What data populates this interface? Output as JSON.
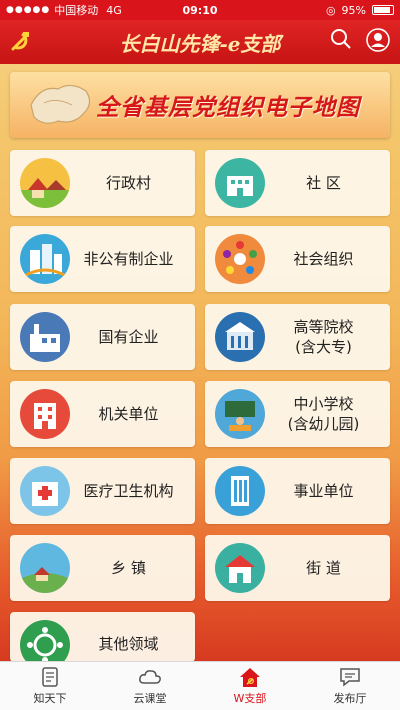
{
  "status_bar": {
    "carrier": "中国移动",
    "network": "4G",
    "time": "09:10",
    "battery": "95%"
  },
  "nav": {
    "title": "长白山先锋-e支部"
  },
  "banner": {
    "text": "全省基层党组织电子地图"
  },
  "categories": [
    {
      "label": "行政村"
    },
    {
      "label": "社 区"
    },
    {
      "label": "非公有制企业"
    },
    {
      "label": "社会组织"
    },
    {
      "label": "国有企业"
    },
    {
      "label": "高等院校\n(含大专)"
    },
    {
      "label": "机关单位"
    },
    {
      "label": "中小学校\n(含幼儿园)"
    },
    {
      "label": "医疗卫生机构"
    },
    {
      "label": "事业单位"
    },
    {
      "label": "乡 镇"
    },
    {
      "label": "街 道"
    },
    {
      "label": "其他领域"
    }
  ],
  "tabs": [
    {
      "label": "知天下",
      "icon": "news-icon"
    },
    {
      "label": "云课堂",
      "icon": "cloud-icon"
    },
    {
      "label": "W支部",
      "icon": "party-home-icon",
      "active": true
    },
    {
      "label": "发布厅",
      "icon": "message-icon"
    }
  ],
  "colors": {
    "primary_red": "#d9141b",
    "gold": "#ffe7a8"
  }
}
